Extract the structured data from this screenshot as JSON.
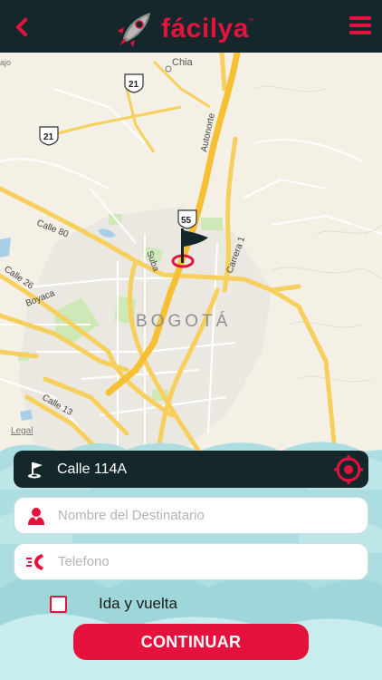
{
  "app": {
    "brand_name": "fácilya",
    "brand_tm": "™",
    "accent_color": "#e5123d",
    "header_color": "#14282c"
  },
  "map": {
    "city_label": "BOGOTÁ",
    "labels": {
      "chia": "Chia",
      "calle80": "Calle 80",
      "calle26": "Calle 26",
      "boyaca": "Boyaca",
      "calle13": "Calle 13",
      "suba": "Suba",
      "autonorte": "Autonorte",
      "carrera1": "Carrera 1",
      "cajica_partial": "ajo"
    },
    "shields": {
      "s21a": "21",
      "s21b": "21",
      "s55": "55"
    },
    "legal": "Legal",
    "marker_icon": "flag-marker-icon"
  },
  "form": {
    "address_value": "Calle 114A",
    "address_icon": "golf-flag-icon",
    "name_placeholder": "Nombre del Destinatario",
    "name_icon": "person-icon",
    "phone_placeholder": "Telefono",
    "phone_icon": "phone-call-icon",
    "locate_icon": "crosshair-icon",
    "roundtrip_label": "Ida y vuelta",
    "roundtrip_checked": false,
    "continue_label": "CONTINUAR"
  }
}
